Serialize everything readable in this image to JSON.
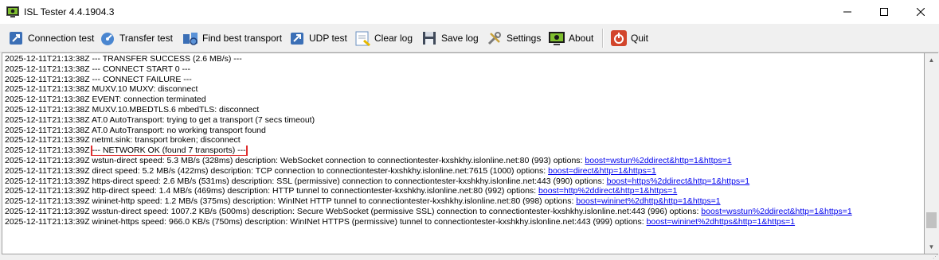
{
  "window": {
    "title": "ISL Tester 4.4.1904.3",
    "controls": {
      "minimize": "—",
      "maximize": "☐",
      "close": "✕"
    }
  },
  "toolbar": {
    "buttons": [
      {
        "label": "Connection test",
        "icon": "connection-test-icon"
      },
      {
        "label": "Transfer test",
        "icon": "transfer-test-icon"
      },
      {
        "label": "Find best transport",
        "icon": "find-best-transport-icon"
      },
      {
        "label": "UDP test",
        "icon": "udp-test-icon"
      },
      {
        "label": "Clear log",
        "icon": "clear-log-icon"
      },
      {
        "label": "Save log",
        "icon": "save-log-icon"
      },
      {
        "label": "Settings",
        "icon": "settings-icon"
      },
      {
        "label": "About",
        "icon": "about-icon"
      },
      {
        "label": "Quit",
        "icon": "quit-icon"
      }
    ]
  },
  "log": {
    "lines": [
      {
        "text": "2025-12-11T21:13:38Z --- TRANSFER SUCCESS (2.6 MB/s) ---"
      },
      {
        "text": "2025-12-11T21:13:38Z --- CONNECT START 0 ---"
      },
      {
        "text": "2025-12-11T21:13:38Z --- CONNECT FAILURE ---"
      },
      {
        "text": "2025-12-11T21:13:38Z MUXV.10 MUXV: disconnect"
      },
      {
        "text": "2025-12-11T21:13:38Z EVENT: connection terminated"
      },
      {
        "text": "2025-12-11T21:13:38Z MUXV.10.MBEDTLS.6 mbedTLS: disconnect"
      },
      {
        "text": "2025-12-11T21:13:38Z AT.0 AutoTransport: trying to get a transport (7 secs timeout)"
      },
      {
        "text": "2025-12-11T21:13:38Z AT.0 AutoTransport: no working transport found"
      },
      {
        "text": "2025-12-11T21:13:39Z netmt.sink: transport broken; disconnect"
      },
      {
        "prefix": "2025-12-11T21:13:39Z ",
        "highlight": "--- NETWORK OK (found 7 transports) ---"
      },
      {
        "text": "2025-12-11T21:13:39Z wstun-direct speed: 5.3 MB/s (328ms) description: WebSocket connection to connectiontester-kxshkhy.islonline.net:80 (993) options: ",
        "link": "boost=wstun%2ddirect&http=1&https=1"
      },
      {
        "text": "2025-12-11T21:13:39Z direct speed: 5.2 MB/s (422ms) description: TCP connection to connectiontester-kxshkhy.islonline.net:7615 (1000) options: ",
        "link": "boost=direct&http=1&https=1"
      },
      {
        "text": "2025-12-11T21:13:39Z https-direct speed: 2.6 MB/s (531ms) description: SSL (permissive) connection to connectiontester-kxshkhy.islonline.net:443 (990) options: ",
        "link": "boost=https%2ddirect&http=1&https=1"
      },
      {
        "text": "2025-12-11T21:13:39Z http-direct speed: 1.4 MB/s (469ms) description: HTTP tunnel to connectiontester-kxshkhy.islonline.net:80 (992) options: ",
        "link": "boost=http%2ddirect&http=1&https=1"
      },
      {
        "text": "2025-12-11T21:13:39Z wininet-http speed: 1.2 MB/s (375ms) description: WinINet HTTP tunnel to connectiontester-kxshkhy.islonline.net:80 (998) options: ",
        "link": "boost=wininet%2dhttp&http=1&https=1"
      },
      {
        "text": "2025-12-11T21:13:39Z wsstun-direct speed: 1007.2 KB/s (500ms) description: Secure WebSocket (permissive SSL) connection to connectiontester-kxshkhy.islonline.net:443 (996) options: ",
        "link": "boost=wsstun%2ddirect&http=1&https=1"
      },
      {
        "text": "2025-12-11T21:13:39Z wininet-https speed: 966.0 KB/s (750ms) description: WinINet HTTPS (permissive) tunnel to connectiontester-kxshkhy.islonline.net:443 (999) options: ",
        "link": "boost=wininet%2dhttps&http=1&https=1"
      }
    ]
  },
  "colors": {
    "link": "#0000ee",
    "highlight_border": "#e03030"
  }
}
